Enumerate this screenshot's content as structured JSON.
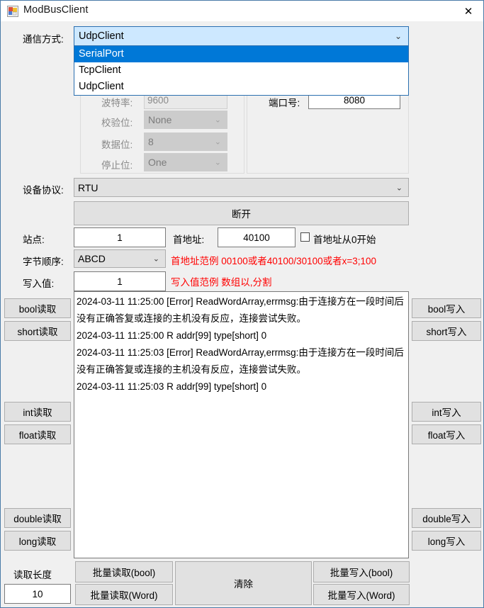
{
  "window": {
    "title": "ModBusClient",
    "icon": "winforms-icon",
    "close_label": "✕"
  },
  "comm": {
    "label": "通信方式:",
    "selected": "UdpClient",
    "options": [
      "SerialPort",
      "TcpClient",
      "UdpClient"
    ],
    "highlighted": "SerialPort",
    "arrow": "⌄"
  },
  "serial": {
    "baud_label": "波特率:",
    "baud_value": "9600",
    "parity_label": "校验位:",
    "parity_value": "None",
    "databits_label": "数据位:",
    "databits_value": "8",
    "stopbits_label": "停止位:",
    "stopbits_value": "One",
    "arrow": "⌄"
  },
  "network": {
    "port_label": "端口号:",
    "port_value": "8080"
  },
  "protocol": {
    "label": "设备协议:",
    "value": "RTU",
    "arrow": "⌄"
  },
  "connect": {
    "label": "断开"
  },
  "params": {
    "station_label": "站点:",
    "station_value": "1",
    "start_addr_label": "首地址:",
    "start_addr_value": "40100",
    "zero_base_label": "首地址从0开始",
    "zero_base_checked": false,
    "byte_order_label": "字节顺序:",
    "byte_order_value": "ABCD",
    "byte_order_arrow": "⌄",
    "addr_hint": "首地址范例 00100或者40100/30100或者x=3;100",
    "write_value_label": "写入值:",
    "write_value": "1",
    "write_hint": "写入值范例 数组以,分割"
  },
  "log": {
    "lines": [
      "2024-03-11 11:25:00 [Error] ReadWordArray,errmsg:由于连接方在一段时间后没有正确答复或连接的主机没有反应，连接尝试失败。",
      "2024-03-11 11:25:00 R addr[99] type[short] 0",
      "2024-03-11 11:25:03 [Error] ReadWordArray,errmsg:由于连接方在一段时间后没有正确答复或连接的主机没有反应，连接尝试失败。",
      "2024-03-11 11:25:03 R addr[99] type[short] 0"
    ]
  },
  "read_buttons": {
    "bool": "bool读取",
    "short": "short读取",
    "int": "int读取",
    "float": "float读取",
    "double": "double读取",
    "long": "long读取"
  },
  "write_buttons": {
    "bool": "bool写入",
    "short": "short写入",
    "int": "int写入",
    "float": "float写入",
    "double": "double写入",
    "long": "long写入"
  },
  "bottom": {
    "read_length_label": "读取长度",
    "read_length_value": "10",
    "batch_read_bool": "批量读取(bool)",
    "batch_read_word": "批量读取(Word)",
    "clear": "清除",
    "batch_write_bool": "批量写入(bool)",
    "batch_write_word": "批量写入(Word)"
  },
  "colors": {
    "accent": "#0078d7",
    "hint": "#ff0000",
    "window_border": "#4a7ba8",
    "face": "#f0f0f0",
    "button_face": "#e1e1e1"
  }
}
